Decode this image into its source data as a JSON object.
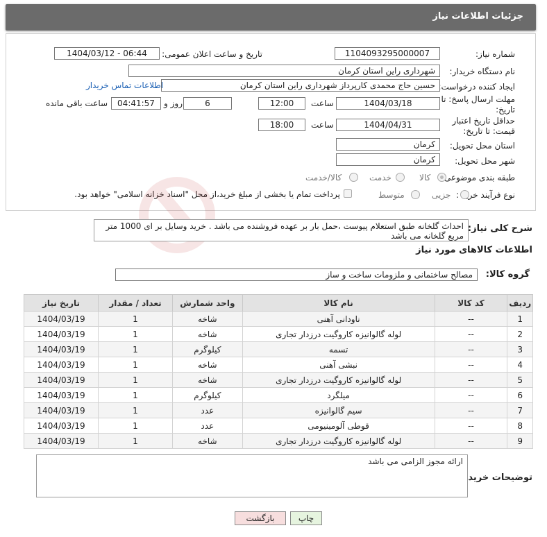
{
  "header": {
    "title": "جزئیات اطلاعات نیاز"
  },
  "form": {
    "need_number_label": "شماره نیاز:",
    "need_number": "1104093295000007",
    "announce_label": "تاریخ و ساعت اعلان عمومی:",
    "announce_value": "1404/03/12 - 06:44",
    "buyer_org_label": "نام دستگاه خریدار:",
    "buyer_org": "شهرداری راین استان کرمان",
    "creator_label": "ایجاد کننده درخواست:",
    "creator": "حسین حاج محمدی کارپرداز شهرداری راین استان کرمان",
    "contact_link": "اطلاعات تماس خریدار",
    "deadline_label": "مهلت ارسال پاسخ: تا تاریخ:",
    "deadline_date": "1404/03/18",
    "time_label": "ساعت",
    "deadline_time": "12:00",
    "days_value": "6",
    "days_label": "روز و",
    "remaining_value": "04:41:57",
    "remaining_label": "ساعت باقی مانده",
    "validity_label": "حداقل تاریخ اعتبار قیمت: تا تاریخ:",
    "validity_date": "1404/04/31",
    "validity_time": "18:00",
    "province_label": "استان محل تحویل:",
    "province": "کرمان",
    "city_label": "شهر محل تحویل:",
    "city": "کرمان",
    "category_label": "طبقه بندی موضوعی:",
    "category_options": [
      "کالا",
      "خدمت",
      "کالا/خدمت"
    ],
    "purchase_type_label": "نوع فرآیند خرید :",
    "purchase_options": [
      "جزیی",
      "متوسط"
    ],
    "payment_note": "پرداخت تمام یا بخشی از مبلغ خرید،از محل \"اسناد خزانه اسلامی\" خواهد بود."
  },
  "description": {
    "label": "شرح کلی نیاز:",
    "text": "احداث گلخانه طبق استعلام پیوست ،حمل بار بر عهده فروشنده می باشد . خرید وسایل بر ای 1000 متر مربع گلخانه می باشد"
  },
  "goods": {
    "section_title": "اطلاعات کالاهای مورد نیاز",
    "group_label": "گروه کالا:",
    "group_value": "مصالح ساختمانی و ملزومات ساخت و ساز",
    "columns": [
      "ردیف",
      "کد کالا",
      "نام کالا",
      "واحد شمارش",
      "تعداد / مقدار",
      "تاریخ نیاز"
    ],
    "rows": [
      {
        "idx": "1",
        "code": "--",
        "name": "ناودانی آهنی",
        "unit": "شاخه",
        "qty": "1",
        "date": "1404/03/19"
      },
      {
        "idx": "2",
        "code": "--",
        "name": "لوله گالوانیزه کاروگیت درزدار تجاری",
        "unit": "شاخه",
        "qty": "1",
        "date": "1404/03/19"
      },
      {
        "idx": "3",
        "code": "--",
        "name": "تسمه",
        "unit": "کیلوگرم",
        "qty": "1",
        "date": "1404/03/19"
      },
      {
        "idx": "4",
        "code": "--",
        "name": "نبشی آهنی",
        "unit": "شاخه",
        "qty": "1",
        "date": "1404/03/19"
      },
      {
        "idx": "5",
        "code": "--",
        "name": "لوله گالوانیزه کاروگیت درزدار تجاری",
        "unit": "شاخه",
        "qty": "1",
        "date": "1404/03/19"
      },
      {
        "idx": "6",
        "code": "--",
        "name": "میلگرد",
        "unit": "کیلوگرم",
        "qty": "1",
        "date": "1404/03/19"
      },
      {
        "idx": "7",
        "code": "--",
        "name": "سیم گالوانیزه",
        "unit": "عدد",
        "qty": "1",
        "date": "1404/03/19"
      },
      {
        "idx": "8",
        "code": "--",
        "name": "قوطی آلومینیومی",
        "unit": "عدد",
        "qty": "1",
        "date": "1404/03/19"
      },
      {
        "idx": "9",
        "code": "--",
        "name": "لوله گالوانیزه کاروگیت درزدار تجاری",
        "unit": "شاخه",
        "qty": "1",
        "date": "1404/03/19"
      }
    ]
  },
  "buyer_notes": {
    "label": "توضیحات خریدار:",
    "text": "ارائه مجوز الزامی می باشد"
  },
  "buttons": {
    "print": "چاپ",
    "back": "بازگشت"
  },
  "colors": {
    "header_bg": "#6b6b6b",
    "link": "#1a5fb4",
    "back_button": "#f7dede",
    "print_button": "#e6f4df"
  },
  "watermark_text": "AriaTender.neT"
}
